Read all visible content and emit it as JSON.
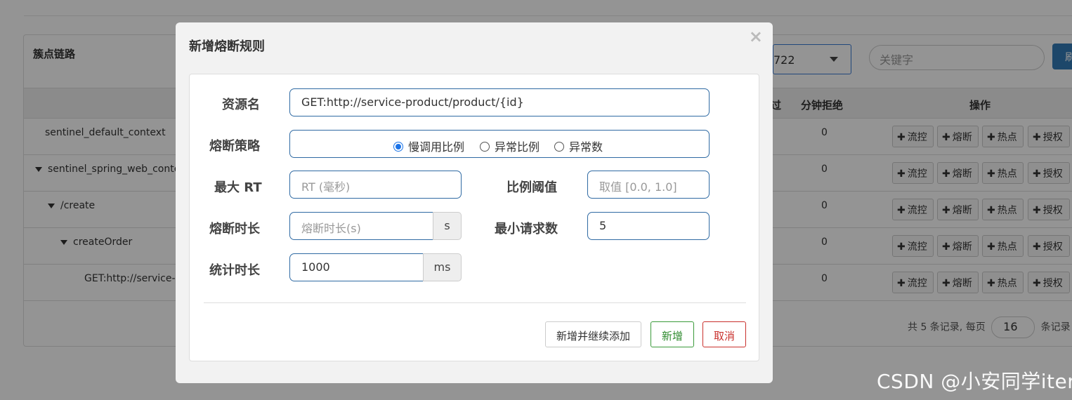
{
  "background": {
    "panel_title": "簇点链路",
    "machine_select": "722",
    "search_placeholder": "关键字",
    "refresh_label": "刷",
    "columns": {
      "passed": "过",
      "rejected": "分钟拒绝",
      "actions": "操作"
    },
    "rows": [
      {
        "label": "sentinel_default_context",
        "value": "0"
      },
      {
        "label": "sentinel_spring_web_conte",
        "value": "0"
      },
      {
        "label": "/create",
        "value": "0"
      },
      {
        "label": "createOrder",
        "value": "0"
      },
      {
        "label": "GET:http://service-p",
        "value": "0"
      }
    ],
    "row_buttons": [
      "流控",
      "熔断",
      "热点",
      "授权"
    ],
    "pager": {
      "prefix": "共 5 条记录, 每页",
      "page_size": "16",
      "suffix": "条记录"
    }
  },
  "modal": {
    "title": "新增熔断规则",
    "close": "×",
    "fields": {
      "resource_label": "资源名",
      "resource_value": "GET:http://service-product/product/{id}",
      "strategy_label": "熔断策略",
      "strategy_options": [
        "慢调用比例",
        "异常比例",
        "异常数"
      ],
      "strategy_selected": "慢调用比例",
      "max_rt_label": "最大 RT",
      "max_rt_placeholder": "RT (毫秒)",
      "ratio_label": "比例阈值",
      "ratio_placeholder": "取值 [0.0, 1.0]",
      "duration_label": "熔断时长",
      "duration_placeholder": "熔断时长(s)",
      "duration_unit": "s",
      "min_request_label": "最小请求数",
      "min_request_value": "5",
      "stat_label": "统计时长",
      "stat_value": "1000",
      "stat_unit": "ms"
    },
    "buttons": {
      "add_continue": "新增并继续添加",
      "add": "新增",
      "cancel": "取消"
    }
  },
  "watermark": "CSDN @小安同学iter",
  "colors": {
    "primary": "#337ab7",
    "input_border": "#2f6aa3",
    "radio_checked": "#1a73e8",
    "success": "#2e8b2e",
    "danger": "#c9302c"
  }
}
